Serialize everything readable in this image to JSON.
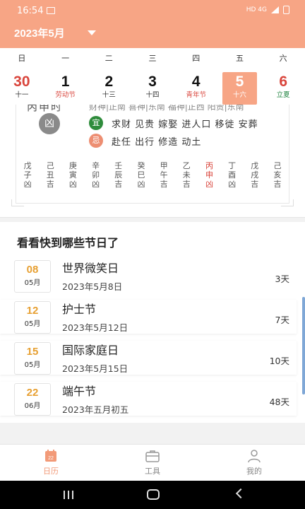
{
  "status_bar": {
    "time": "16:54",
    "right": "HD 4G"
  },
  "header": {
    "month_title": "2023年5月"
  },
  "colors": {
    "accent": "#f7a585",
    "red": "#d9453c",
    "green": "#2b8a4a",
    "gold": "#e7a032"
  },
  "weekdays": [
    "日",
    "一",
    "二",
    "三",
    "四",
    "五",
    "六"
  ],
  "dates": [
    {
      "num": "30",
      "sub": "十一"
    },
    {
      "num": "1",
      "sub": "劳动节"
    },
    {
      "num": "2",
      "sub": "十三"
    },
    {
      "num": "3",
      "sub": "十四"
    },
    {
      "num": "4",
      "sub": "青年节"
    },
    {
      "num": "5",
      "sub": "十六"
    },
    {
      "num": "6",
      "sub": "立夏"
    }
  ],
  "almanac": {
    "clipped_top": "财神|正南 喜神|东南 福神|正西 阳贵|东南",
    "clipped_left": "丙申时",
    "luck": "凶",
    "yi_label": "宜",
    "yi_text": "求财  见贵  嫁娶  进人口  移徙  安葬",
    "ji_label": "忌",
    "ji_text": "赴任  出行  修造  动土",
    "ganzhi": [
      {
        "l1": "戊",
        "l2": "子",
        "l3": "凶"
      },
      {
        "l1": "己",
        "l2": "丑",
        "l3": "吉"
      },
      {
        "l1": "庚",
        "l2": "寅",
        "l3": "凶"
      },
      {
        "l1": "辛",
        "l2": "卯",
        "l3": "凶"
      },
      {
        "l1": "壬",
        "l2": "辰",
        "l3": "吉"
      },
      {
        "l1": "癸",
        "l2": "巳",
        "l3": "凶"
      },
      {
        "l1": "甲",
        "l2": "午",
        "l3": "吉"
      },
      {
        "l1": "乙",
        "l2": "未",
        "l3": "吉"
      },
      {
        "l1": "丙",
        "l2": "申",
        "l3": "凶"
      },
      {
        "l1": "丁",
        "l2": "酉",
        "l3": "凶"
      },
      {
        "l1": "戊",
        "l2": "戌",
        "l3": "吉"
      },
      {
        "l1": "己",
        "l2": "亥",
        "l3": "吉"
      }
    ]
  },
  "festivals": {
    "heading": "看看快到哪些节日了",
    "items": [
      {
        "day": "08",
        "month": "05月",
        "name": "世界微笑日",
        "date": "2023年5月8日",
        "countdown": "3天"
      },
      {
        "day": "12",
        "month": "05月",
        "name": "护士节",
        "date": "2023年5月12日",
        "countdown": "7天"
      },
      {
        "day": "15",
        "month": "05月",
        "name": "国际家庭日",
        "date": "2023年5月15日",
        "countdown": "10天"
      },
      {
        "day": "22",
        "month": "06月",
        "name": "端午节",
        "date": "2023年五月初五",
        "countdown": "48天"
      }
    ]
  },
  "bottom_nav": {
    "calendar_label": "日历",
    "calendar_icon_day": "22",
    "tools_label": "工具",
    "profile_label": "我的"
  }
}
